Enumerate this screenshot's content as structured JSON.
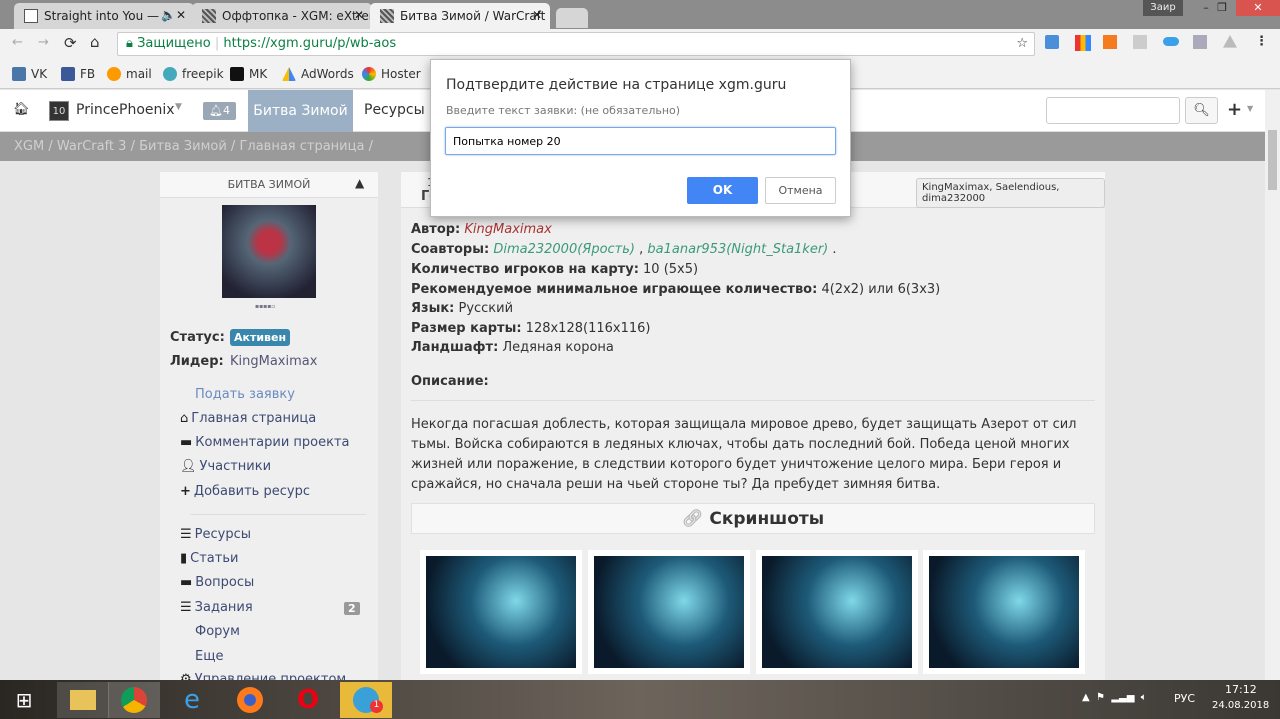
{
  "browser": {
    "tabs": [
      {
        "title": "Straight into You — L"
      },
      {
        "title": "Оффтопка - XGM: eXtrer"
      },
      {
        "title": "Битва Зимой / WarCraft"
      }
    ],
    "user": "Заир",
    "secure_label": "Защищено",
    "url": "https://xgm.guru/p/wb-aos",
    "bookmarks": [
      "VK",
      "FB",
      "mail",
      "freepik",
      "MK",
      "AdWords",
      "Hoster"
    ]
  },
  "site": {
    "username": "PrincePhoenix",
    "user_level": "10",
    "notifications": "4",
    "nav": [
      "Битва Зимой",
      "Ресурсы"
    ],
    "breadcrumb": [
      "XGM",
      "WarCraft 3",
      "Битва Зимой",
      "Главная страница"
    ]
  },
  "sidebar": {
    "title": "БИТВА ЗИМОЙ",
    "status_label": "Статус:",
    "status": "Активен",
    "leader_label": "Лидер:",
    "leader": "KingMaximax",
    "apply": "Подать заявку",
    "links": [
      "Главная страница",
      "Комментарии проекта",
      "Участники",
      "Добавить ресурс"
    ],
    "menu": [
      "Ресурсы",
      "Статьи",
      "Вопросы",
      "Задания",
      "Форум",
      "Еще",
      "Управление проектом"
    ],
    "tasks_count": "2"
  },
  "main": {
    "header_num": "1",
    "header_title": "Го",
    "authors_badge": "KingMaximax, Saelendious, dima232000",
    "author_label": "Автор:",
    "author": "KingMaximax",
    "coauthors_label": "Соавторы:",
    "coauthor1": "Dima232000(Ярость)",
    "coauthor2": "ba1anar953(Night_Sta1ker)",
    "players_label": "Количество игроков на карту:",
    "players": "10 (5x5)",
    "min_label": "Рекомендуемое минимальное играющее количество:",
    "min": "4(2x2) или 6(3x3)",
    "lang_label": "Язык:",
    "lang": "Русский",
    "size_label": "Размер карты:",
    "size": "128x128(116x116)",
    "terrain_label": "Ландшафт:",
    "terrain": "Ледяная корона",
    "desc_label": "Описание:",
    "desc": "Некогда погасшая доблесть, которая защищала мировое древо, будет защищать Азерот от сил тьмы. Войска собираются в ледяных ключах, чтобы дать последний бой. Победа ценой многих жизней или поражение, в следствии которого будет уничтожение целого мира. Бери героя и сражайся, но сначала реши на чьей стороне ты? Да пребудет зимняя битва.",
    "screens_title": "Скриншоты"
  },
  "dialog": {
    "title": "Подтвердите действие на странице xgm.guru",
    "prompt": "Введите текст заявки: (не обязательно)",
    "value": "Попытка номер 20",
    "ok": "OK",
    "cancel": "Отмена"
  },
  "taskbar": {
    "lang": "РУС",
    "time": "17:12",
    "date": "24.08.2018",
    "telegram_badge": "1"
  }
}
